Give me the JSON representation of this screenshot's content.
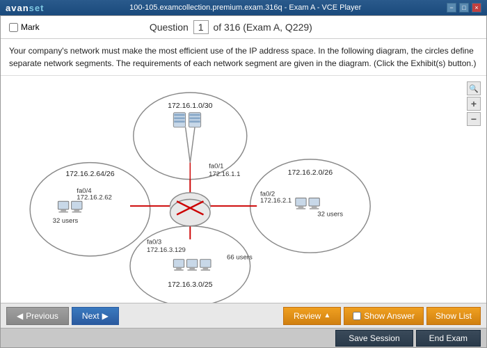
{
  "titlebar": {
    "logo": "avan",
    "logo2": "set",
    "title": "100-105.examcollection.premium.exam.316q - Exam A - VCE Player",
    "win_min": "−",
    "win_max": "□",
    "win_close": "×"
  },
  "header": {
    "mark_label": "Mark",
    "question_label": "Question",
    "question_num": "1",
    "question_total": "of 316 (Exam A, Q229)"
  },
  "question": {
    "text": "Your company's network must make the most efficient use of the IP address space. In the following diagram, the circles define separate network segments. The requirements of each network segment are given in the diagram. (Click the Exhibit(s) button.)"
  },
  "diagram": {
    "top_network": "172.16.1.0/30",
    "top_iface": "fa0/1",
    "top_ip": "172.16.1.1",
    "left_network": "172.16.2.64/26",
    "left_iface": "fa0/4",
    "left_ip": "172.16.2.62",
    "left_users": "32 users",
    "right_network": "172.16.2.0/26",
    "right_iface": "fa0/2",
    "right_ip": "172.16.2.1",
    "right_users": "32 users",
    "bottom_iface": "fa0/3",
    "bottom_ip": "172.16.3.129",
    "bottom_users": "66 users",
    "bottom_network": "172.16.3.0/25"
  },
  "toolbar": {
    "prev_label": "Previous",
    "next_label": "Next",
    "review_label": "Review",
    "show_answer_label": "Show Answer",
    "show_list_label": "Show List",
    "save_label": "Save Session",
    "end_label": "End Exam"
  },
  "zoom": {
    "plus": "+",
    "minus": "−"
  }
}
